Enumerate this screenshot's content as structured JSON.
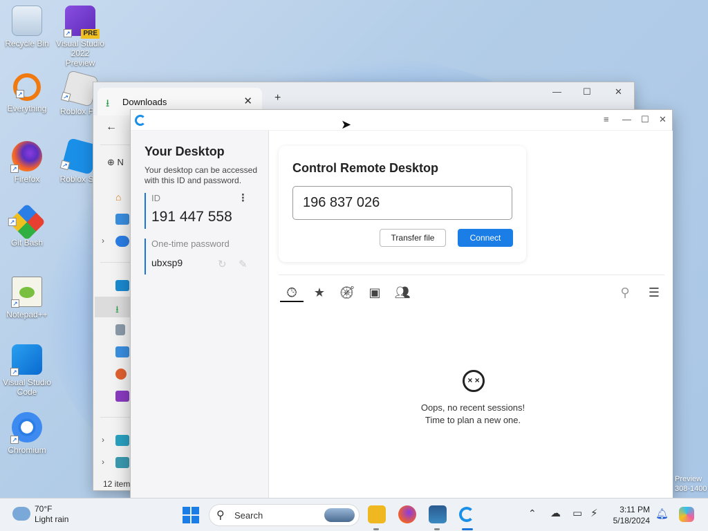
{
  "desktop": {
    "icons": [
      {
        "label": "Recycle Bin"
      },
      {
        "label": "Visual Studio 2022 Preview"
      },
      {
        "label": "Everything"
      },
      {
        "label": "Roblox Pla"
      },
      {
        "label": "Firefox"
      },
      {
        "label": "Roblox Stu"
      },
      {
        "label": "Git Bash"
      },
      {
        "label": "Notepad++"
      },
      {
        "label": "Visual Studio Code"
      },
      {
        "label": "Chromium"
      }
    ],
    "badge_pre": "PRE",
    "watermark_line1": "Preview",
    "watermark_line2": "308-1400"
  },
  "explorer": {
    "tab_label": "Downloads",
    "close_glyph": "✕",
    "plus_glyph": "+",
    "back_glyph": "←",
    "new_label": "N",
    "item_count": "12 item"
  },
  "rustdesk": {
    "your_desktop_title": "Your Desktop",
    "your_desktop_desc": "Your desktop can be accessed with this ID and password.",
    "id_caption": "ID",
    "id_value": "191 447 558",
    "password_caption": "One-time password",
    "password_value": "ubxsp9",
    "control_title": "Control Remote Desktop",
    "remote_id_value": "196 837 026",
    "transfer_button": "Transfer file",
    "connect_button": "Connect",
    "empty_line1": "Oops, no recent sessions!",
    "empty_line2": "Time to plan a new one.",
    "tabs": [
      "recent-sessions",
      "favorites",
      "discovered",
      "address-book",
      "group"
    ]
  },
  "taskbar": {
    "weather_temp": "70°F",
    "weather_desc": "Light rain",
    "search_label": "Search",
    "time": "3:11 PM",
    "date": "5/18/2024"
  },
  "colors": {
    "accent": "#1a7ee6",
    "id_bar": "#1a74d8"
  }
}
